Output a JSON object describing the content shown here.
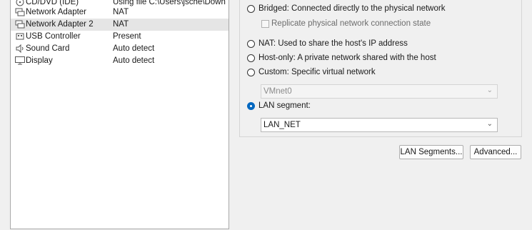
{
  "hardware": {
    "rows": [
      {
        "name": "CD/DVD (IDE)",
        "summary": "Using file C:\\Users\\jsche\\Down",
        "icon": "cd-dvd-icon"
      },
      {
        "name": "Network Adapter",
        "summary": "NAT",
        "icon": "network-adapter-icon"
      },
      {
        "name": "Network Adapter 2",
        "summary": "NAT",
        "icon": "network-adapter-icon"
      },
      {
        "name": "USB Controller",
        "summary": "Present",
        "icon": "usb-controller-icon"
      },
      {
        "name": "Sound Card",
        "summary": "Auto detect",
        "icon": "sound-card-icon"
      },
      {
        "name": "Display",
        "summary": "Auto detect",
        "icon": "display-icon"
      }
    ],
    "selected_index": 2
  },
  "network_connection": {
    "bridged_label": "Bridged: Connected directly to the physical network",
    "replicate_label": "Replicate physical network connection state",
    "nat_label": "NAT: Used to share the host's IP address",
    "hostonly_label": "Host-only: A private network shared with the host",
    "custom_label": "Custom: Specific virtual network",
    "custom_value": "VMnet0",
    "lan_label": "LAN segment:",
    "lan_value": "LAN_NET",
    "selected": "lan_segment"
  },
  "buttons": {
    "lan_segments": "LAN Segments...",
    "advanced": "Advanced..."
  },
  "colors": {
    "accent": "#0067c0",
    "selected_row": "#e5e5e5"
  }
}
